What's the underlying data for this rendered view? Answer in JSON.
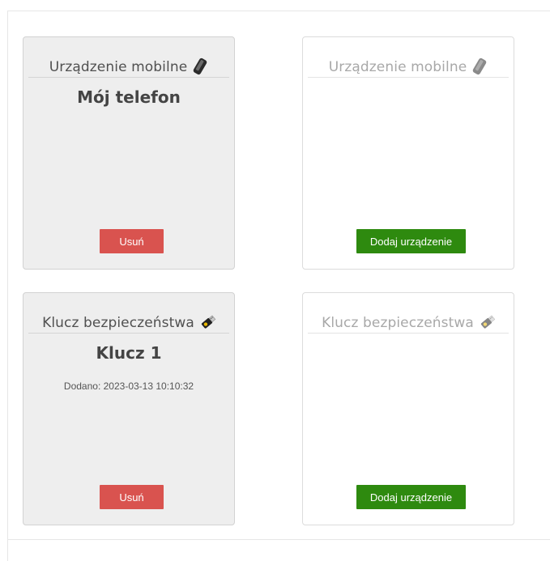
{
  "cards": [
    {
      "type_label": "Urządzenie mobilne",
      "icon": "phone-icon",
      "state": "active",
      "device_name": "Mój telefon",
      "button_label": "Usuń"
    },
    {
      "type_label": "Urządzenie mobilne",
      "icon": "phone-icon",
      "state": "empty",
      "button_label": "Dodaj urządzenie"
    },
    {
      "type_label": "Klucz bezpieczeństwa",
      "icon": "usb-key-icon",
      "state": "active",
      "device_name": "Klucz 1",
      "added_label": "Dodano: 2023-03-13 10:10:32",
      "button_label": "Usuń"
    },
    {
      "type_label": "Klucz bezpieczeństwa",
      "icon": "usb-key-icon",
      "state": "empty",
      "button_label": "Dodaj urządzenie"
    }
  ],
  "colors": {
    "remove_button": "#d9534f",
    "add_button": "#2e8a0f",
    "active_card_bg": "#eeeeee"
  }
}
